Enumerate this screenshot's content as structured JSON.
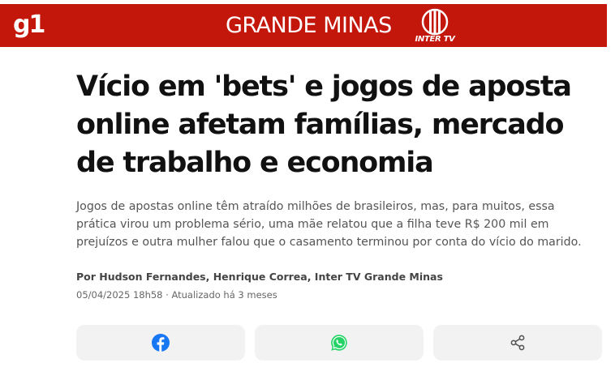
{
  "header": {
    "logo_text": "g1",
    "section_title": "GRANDE MINAS",
    "affiliate_logo_text": "INTER TV",
    "background_color": "#c4170c"
  },
  "article": {
    "headline": "Vício em 'bets' e jogos de aposta online afetam famílias, mercado de trabalho e economia",
    "summary": "Jogos de apostas online têm atraído milhões de brasileiros, mas, para muitos, essa prática virou um problema sério, uma mãe relatou que a filha teve R$ 200 mil em prejuízos e outra mulher falou que o casamento terminou por conta do vício do marido.",
    "byline": "Por Hudson Fernandes, Henrique Correa, Inter TV Grande Minas",
    "dateline": "05/04/2025 18h58 · Atualizado há 3 meses"
  },
  "share": {
    "buttons": [
      {
        "icon": "facebook-icon",
        "color": "#1877f2"
      },
      {
        "icon": "whatsapp-icon",
        "color": "#25d366"
      },
      {
        "icon": "share-icon",
        "color": "#555555"
      }
    ]
  }
}
